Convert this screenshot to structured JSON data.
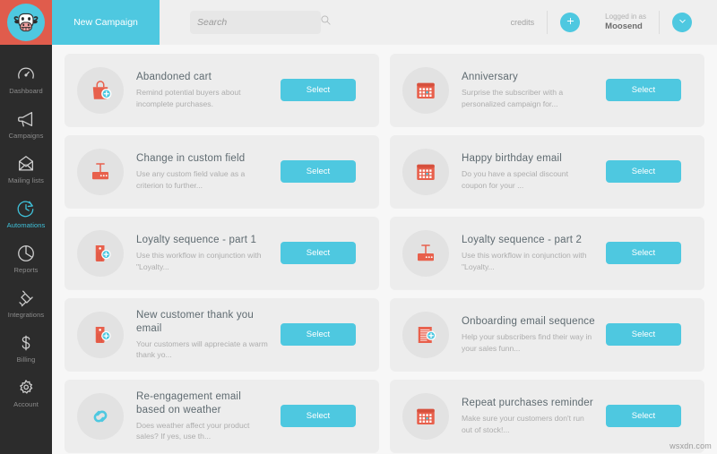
{
  "brand": {
    "logo_icon": "cow-mascot-logo",
    "logo_bg": "#e05c4c",
    "logo_circle": "#4ec8e0",
    "accent": "#4ec8e0",
    "sidebar_bg": "#2c2c2c",
    "content_bg": "#f7f7f7",
    "card_bg": "#ededed",
    "icon_red": "#e8604c"
  },
  "topbar": {
    "new_campaign_label": "New Campaign",
    "search": {
      "placeholder": "Search",
      "value": "",
      "icon": "search-icon"
    },
    "credits_label": "credits",
    "add_credits_icon": "plus-icon",
    "logged_in_prefix": "Logged in as",
    "account_name": "Moosend",
    "account_menu_icon": "chevron-down-icon"
  },
  "sidebar": {
    "items": [
      {
        "label": "Dashboard",
        "icon": "gauge-icon",
        "active": false
      },
      {
        "label": "Campaigns",
        "icon": "megaphone-icon",
        "active": false
      },
      {
        "label": "Mailing lists",
        "icon": "envelope-icon",
        "active": false
      },
      {
        "label": "Automations",
        "icon": "clock-arrow-icon",
        "active": true
      },
      {
        "label": "Reports",
        "icon": "pie-chart-icon",
        "active": false
      },
      {
        "label": "Integrations",
        "icon": "plug-icon",
        "active": false
      },
      {
        "label": "Billing",
        "icon": "dollar-icon",
        "active": false
      },
      {
        "label": "Account",
        "icon": "gear-icon",
        "active": false
      }
    ]
  },
  "main": {
    "select_label": "Select",
    "recipes": [
      {
        "title": "Abandoned cart",
        "description": "Remind potential buyers about incomplete purchases.",
        "icon": "shopping-bag-plus-icon"
      },
      {
        "title": "Anniversary",
        "description": "Surprise the subscriber with a personalized campaign for...",
        "icon": "calendar-icon"
      },
      {
        "title": "Change in custom field",
        "description": "Use any custom field value as a criterion to further...",
        "icon": "custom-field-icon"
      },
      {
        "title": "Happy birthday email",
        "description": "Do you have a special discount coupon for your ...",
        "icon": "calendar-icon"
      },
      {
        "title": "Loyalty sequence - part 1",
        "description": "Use this workflow in conjunction with \"Loyalty...",
        "icon": "tag-plus-icon"
      },
      {
        "title": "Loyalty sequence - part 2",
        "description": "Use this workflow in conjunction with \"Loyalty...",
        "icon": "custom-field-icon"
      },
      {
        "title": "New customer thank you email",
        "description": "Your customers will appreciate a warm thank yo...",
        "icon": "tag-plus-icon"
      },
      {
        "title": "Onboarding email sequence",
        "description": "Help your subscribers find their way in your sales funn...",
        "icon": "document-plus-icon"
      },
      {
        "title": "Re-engagement email based on weather",
        "description": "Does weather affect your product sales? If yes, use th...",
        "icon": "link-chain-icon"
      },
      {
        "title": "Repeat purchases reminder",
        "description": "Make sure your customers don't run out of stock!...",
        "icon": "calendar-icon"
      }
    ]
  },
  "watermark": "wsxdn.com"
}
